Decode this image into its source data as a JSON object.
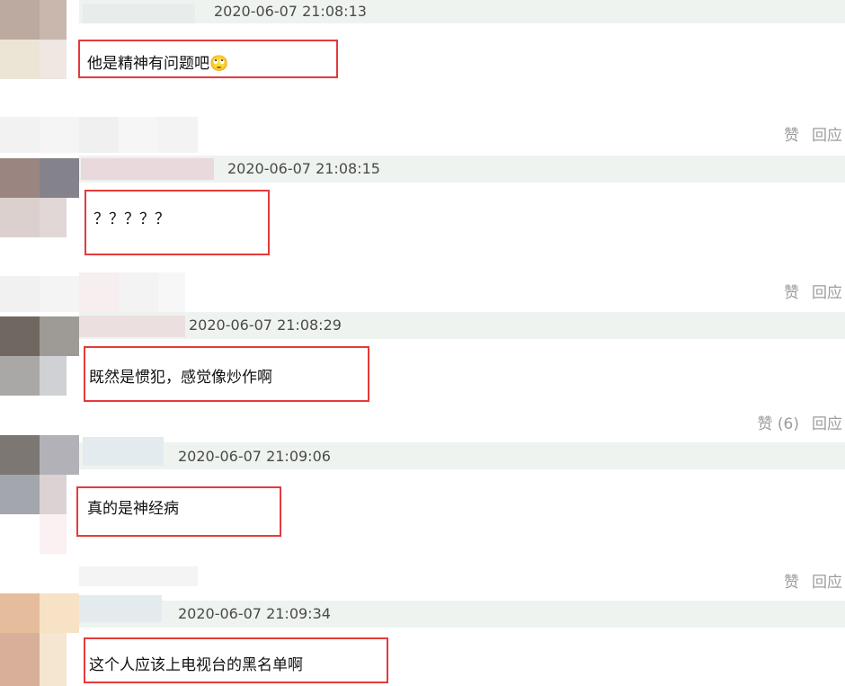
{
  "comments": [
    {
      "time": "2020-06-07 21:08:13",
      "text": "他是精神有问题吧🙄",
      "like": "赞",
      "reply": "回应"
    },
    {
      "time": "2020-06-07 21:08:15",
      "text": "？？？？？",
      "like": "赞",
      "reply": "回应"
    },
    {
      "time": "2020-06-07 21:08:29",
      "text": "既然是惯犯，感觉像炒作啊",
      "like": "赞 (6)",
      "reply": "回应"
    },
    {
      "time": "2020-06-07 21:09:06",
      "text": "真的是神经病",
      "like": "赞",
      "reply": "回应"
    },
    {
      "time": "2020-06-07 21:09:34",
      "text": "这个人应该上电视台的黑名单啊"
    }
  ],
  "colors": {
    "highlight_border": "#e53a3a",
    "meta_bar": "#eef3f0",
    "action_text": "#9c9c9c"
  }
}
